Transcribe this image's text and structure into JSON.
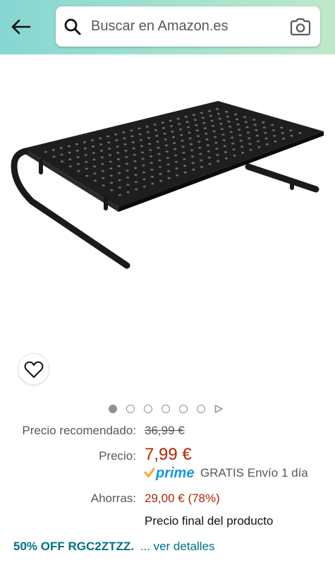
{
  "header": {
    "search_placeholder": "Buscar en Amazon.es",
    "icons": [
      "back-arrow-icon",
      "search-icon",
      "camera-icon"
    ]
  },
  "gallery": {
    "image": "black perforated metal monitor riser stand",
    "dot_count": 6,
    "active_index": 0
  },
  "pricing": {
    "list_label": "Precio recomendado:",
    "list_price": "36,99 €",
    "price_label": "Precio:",
    "price": "7,99 €",
    "prime_label": "prime",
    "shipping": "GRATIS Envío 1 día",
    "savings_label": "Ahorras:",
    "savings": "29,00 € (78%)",
    "final_price_note": "Precio final del producto"
  },
  "coupon": {
    "code_text": "50% OFF RGC2ZTZZ.",
    "link_text": "... ver detalles"
  },
  "colors": {
    "price": "#b12704",
    "link": "#007185",
    "prime_blue": "#1399d6",
    "prime_check": "#f7a833",
    "header_start": "#86d6d2",
    "header_end": "#bfe9c9"
  }
}
